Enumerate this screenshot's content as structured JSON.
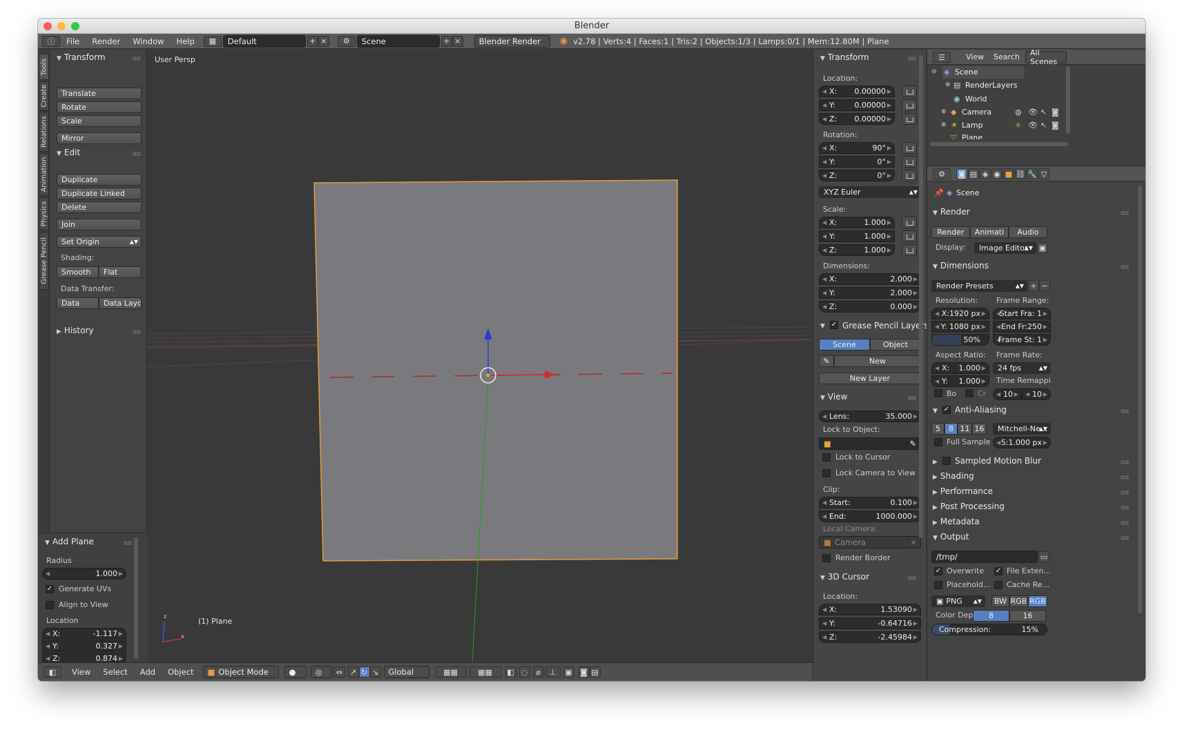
{
  "window": {
    "title": "Blender"
  },
  "topbar": {
    "menus": [
      "File",
      "Render",
      "Window",
      "Help"
    ],
    "layout": "Default",
    "scene": "Scene",
    "engine": "Blender Render",
    "stats": "v2.78 | Verts:4 | Faces:1 | Tris:2 | Objects:1/3 | Lamps:0/1 | Mem:12.80M | Plane"
  },
  "toolshelf": {
    "tabs": [
      "Tools",
      "Create",
      "Relations",
      "Animation",
      "Physics",
      "Grease Pencil"
    ],
    "transform": {
      "header": "Transform",
      "buttons": [
        "Translate",
        "Rotate",
        "Scale",
        "Mirror"
      ]
    },
    "edit": {
      "header": "Edit",
      "buttons": [
        "Duplicate",
        "Duplicate Linked",
        "Delete",
        "Join"
      ],
      "set_origin": "Set Origin",
      "shading_label": "Shading:",
      "smooth": "Smooth",
      "flat": "Flat",
      "data_transfer_label": "Data Transfer:",
      "data": "Data",
      "data_layo": "Data Layo"
    },
    "history": "History",
    "operator": {
      "header": "Add Plane",
      "radius_label": "Radius",
      "radius": "1.000",
      "generate_uvs": "Generate UVs",
      "align_to_view": "Align to View",
      "location_label": "Location",
      "loc": [
        {
          "k": "X:",
          "v": "-1.117"
        },
        {
          "k": "Y:",
          "v": "0.327"
        },
        {
          "k": "Z:",
          "v": "0.874"
        }
      ]
    }
  },
  "viewport": {
    "view_name": "User Persp",
    "object_label": "(1) Plane"
  },
  "bottombar": {
    "menus": [
      "View",
      "Select",
      "Add",
      "Object"
    ],
    "mode": "Object Mode",
    "orientation": "Global"
  },
  "npanel": {
    "transform": "Transform",
    "location_label": "Location:",
    "location": [
      {
        "k": "X:",
        "v": "0.00000"
      },
      {
        "k": "Y:",
        "v": "0.00000"
      },
      {
        "k": "Z:",
        "v": "0.00000"
      }
    ],
    "rotation_label": "Rotation:",
    "rotation": [
      {
        "k": "X:",
        "v": "90°"
      },
      {
        "k": "Y:",
        "v": "0°"
      },
      {
        "k": "Z:",
        "v": "0°"
      }
    ],
    "rotation_mode": "XYZ Euler",
    "scale_label": "Scale:",
    "scale": [
      {
        "k": "X:",
        "v": "1.000"
      },
      {
        "k": "Y:",
        "v": "1.000"
      },
      {
        "k": "Z:",
        "v": "1.000"
      }
    ],
    "dimensions_label": "Dimensions:",
    "dimensions": [
      {
        "k": "X:",
        "v": "2.000"
      },
      {
        "k": "Y:",
        "v": "2.000"
      },
      {
        "k": "Z:",
        "v": "0.000"
      }
    ],
    "gp_layers": "Grease Pencil Layers",
    "gp_scene": "Scene",
    "gp_object": "Object",
    "gp_new": "New",
    "gp_new_layer": "New Layer",
    "view": "View",
    "lens_label": "Lens:",
    "lens": "35.000",
    "lock_to_object": "Lock to Object:",
    "lock_to_cursor": "Lock to Cursor",
    "lock_camera": "Lock Camera to View",
    "clip_label": "Clip:",
    "clip": [
      {
        "k": "Start:",
        "v": "0.100"
      },
      {
        "k": "End:",
        "v": "1000.000"
      }
    ],
    "local_camera": "Local Camera:",
    "camera": "Camera",
    "render_border": "Render Border",
    "cursor_3d": "3D Cursor",
    "cursor_location_label": "Location:",
    "cursor_location": [
      {
        "k": "X:",
        "v": "1.53090"
      },
      {
        "k": "Y:",
        "v": "-0.64716"
      },
      {
        "k": "Z:",
        "v": "-2.45984"
      }
    ]
  },
  "outliner": {
    "view": "View",
    "search": "Search",
    "filter": "All Scenes",
    "items": [
      "Scene",
      "RenderLayers",
      "World",
      "Camera",
      "Lamp",
      "Plane"
    ]
  },
  "properties": {
    "context": "Scene",
    "render": "Render",
    "render_btn": "Render",
    "animation_btn": "Animati",
    "audio_btn": "Audio",
    "display_label": "Display:",
    "display": "Image Editor",
    "dimensions": "Dimensions",
    "presets": "Render Presets",
    "resolution_label": "Resolution:",
    "res_x": "X:1920 px",
    "res_y": "Y: 1080 px",
    "res_pct": "50%",
    "frame_range_label": "Frame Range:",
    "start": "Start Fra: 1",
    "end": "End Fr:250",
    "step": "Frame St: 1",
    "aspect_label": "Aspect Ratio:",
    "asp_x": "1.000",
    "asp_y": "1.000",
    "asp_kx": "X:",
    "asp_ky": "Y:",
    "frame_rate_label": "Frame Rate:",
    "fps": "24 fps",
    "time_remap": "Time Remappi",
    "bo": "Bo",
    "cr": "Cr",
    "remap_old": "10",
    "remap_new": "10",
    "aa": "Anti-Aliasing",
    "aa_samples": [
      "5",
      "8",
      "11",
      "16"
    ],
    "aa_filter": "Mitchell-Ne...",
    "full_sample": "Full Sample",
    "filter_size": "S:1.000 px",
    "collapsed": [
      "Sampled Motion Blur",
      "Shading",
      "Performance",
      "Post Processing",
      "Metadata"
    ],
    "output": "Output",
    "path": "/tmp/",
    "overwrite": "Overwrite",
    "file_ext": "File Exten...",
    "placeholders": "Placehold...",
    "cache": "Cache Re...",
    "format": "PNG",
    "bw": "BW",
    "rgb": "RGB",
    "rgba": "RGB",
    "color_depth_label": "Color Dep",
    "depth8": "8",
    "depth16": "16",
    "compression": "Compression:",
    "compression_val": "15%"
  }
}
